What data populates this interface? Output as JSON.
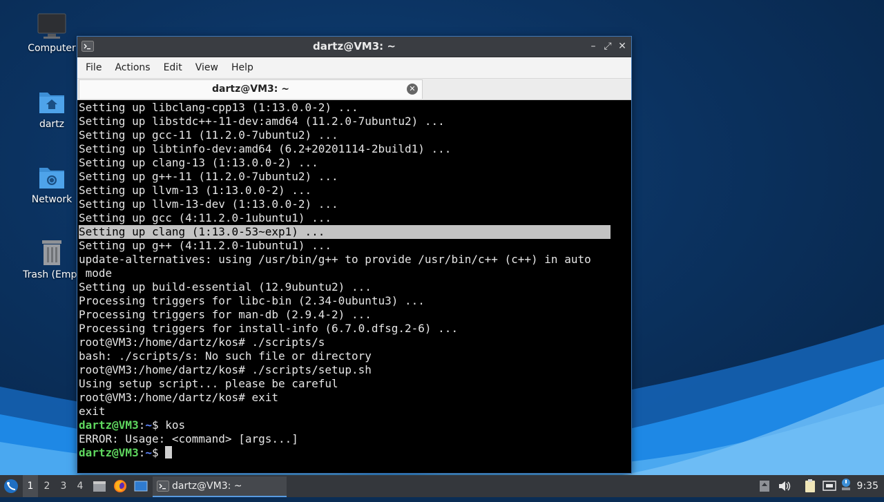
{
  "desktop": {
    "icons": [
      {
        "label": "Computer"
      },
      {
        "label": "dartz"
      },
      {
        "label": "Network"
      },
      {
        "label": "Trash (Empt"
      }
    ]
  },
  "window": {
    "title": "dartz@VM3: ~",
    "menu": [
      "File",
      "Actions",
      "Edit",
      "View",
      "Help"
    ],
    "tab_title": "dartz@VM3: ~",
    "buttons": {
      "minimize": "–",
      "maximize": "⤢",
      "close": "✕"
    }
  },
  "terminal": {
    "lines": [
      "Setting up libclang-cpp13 (1:13.0.0-2) ...",
      "Setting up libstdc++-11-dev:amd64 (11.2.0-7ubuntu2) ...",
      "Setting up gcc-11 (11.2.0-7ubuntu2) ...",
      "Setting up libtinfo-dev:amd64 (6.2+20201114-2build1) ...",
      "Setting up clang-13 (1:13.0.0-2) ...",
      "Setting up g++-11 (11.2.0-7ubuntu2) ...",
      "Setting up llvm-13 (1:13.0.0-2) ...",
      "Setting up llvm-13-dev (1:13.0.0-2) ...",
      "Setting up gcc (4:11.2.0-1ubuntu1) ...",
      "Setting up clang (1:13.0-53~exp1) ...",
      "Setting up g++ (4:11.2.0-1ubuntu1) ...",
      "update-alternatives: using /usr/bin/g++ to provide /usr/bin/c++ (c++) in auto",
      " mode",
      "Setting up build-essential (12.9ubuntu2) ...",
      "Processing triggers for libc-bin (2.34-0ubuntu3) ...",
      "Processing triggers for man-db (2.9.4-2) ...",
      "Processing triggers for install-info (6.7.0.dfsg.2-6) ...",
      "root@VM3:/home/dartz/kos# ./scripts/s",
      "bash: ./scripts/s: No such file or directory",
      "root@VM3:/home/dartz/kos# ./scripts/setup.sh",
      "Using setup script... please be careful",
      "root@VM3:/home/dartz/kos# exit",
      "exit"
    ],
    "highlighted_line": "Setting up clang (1:13.0-53~exp1) ...",
    "prompt_user": "dartz@VM3",
    "prompt_path": "~",
    "prompt_symbol": "$ ",
    "cmd1": "kos",
    "error_line": "ERROR: Usage: <command> [args...]"
  },
  "taskbar": {
    "workspaces": [
      "1",
      "2",
      "3",
      "4"
    ],
    "active_workspace": "1",
    "task_label": "dartz@VM3: ~",
    "clock": "9:35"
  },
  "colors": {
    "prompt_user": "#5fd75f",
    "prompt_path": "#5f87ff",
    "window_border": "#3f78b9",
    "taskbar": "#34373c"
  }
}
